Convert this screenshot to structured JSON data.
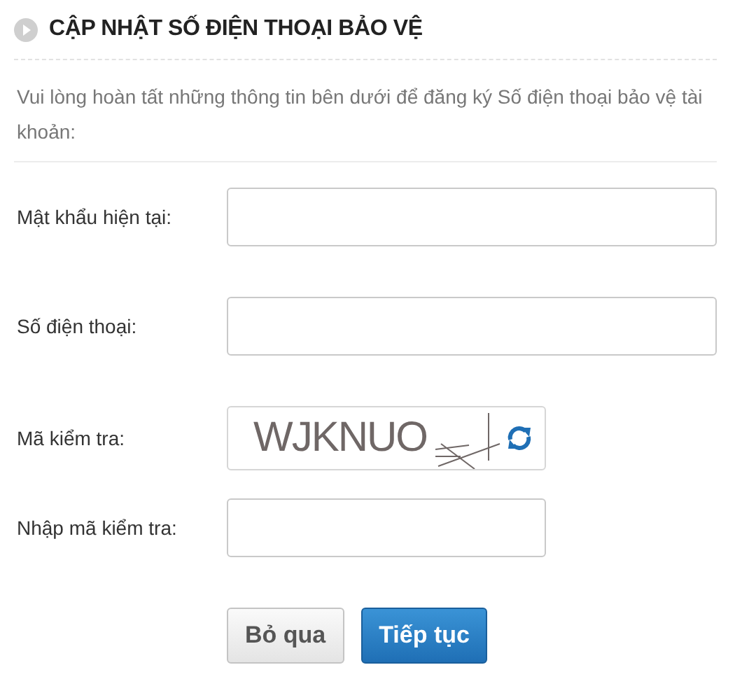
{
  "title": "CẬP NHẬT SỐ ĐIỆN THOẠI BẢO VỆ",
  "intro": "Vui lòng hoàn tất những thông tin bên dưới để đăng ký Số điện thoại bảo vệ tài khoản:",
  "fields": [
    {
      "kind": "input",
      "label": "Mật khẩu hiện tại:"
    },
    {
      "kind": "input",
      "label": "Số điện thoại:"
    },
    {
      "kind": "captcha",
      "label": "Mã kiểm tra:",
      "captcha": "WJKNUO"
    },
    {
      "kind": "short-input",
      "label": "Nhập mã kiểm tra:"
    }
  ],
  "buttons": [
    {
      "kind": "secondary",
      "label": "Bỏ qua"
    },
    {
      "kind": "primary",
      "label": "Tiếp tục"
    }
  ]
}
